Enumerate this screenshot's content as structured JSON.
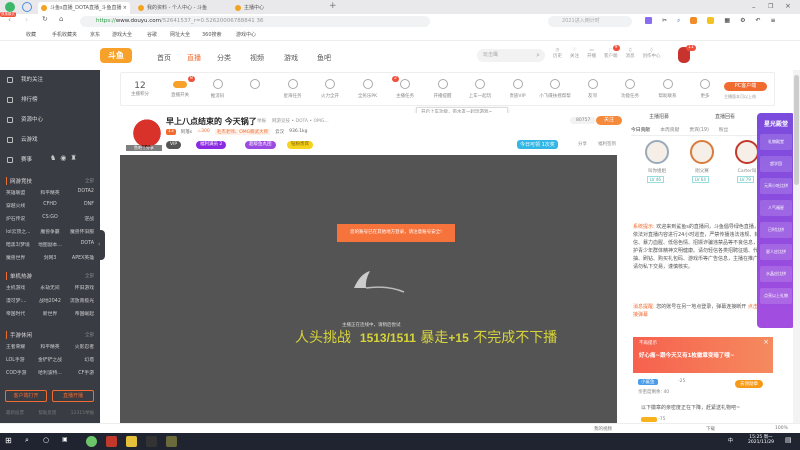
{
  "browser": {
    "tabs": [
      {
        "label": "斗鱼s直播_DOTA直播_斗鱼直播"
      },
      {
        "label": "我的资料 - 个人中心 - 斗鱼"
      },
      {
        "label": "主播中心"
      }
    ],
    "new_tab": "+",
    "badge": "双核模式",
    "url_scheme": "https://",
    "url_host": "www.douyu.com",
    "url_path": "/52641537_r=0.52620006788841 36",
    "search_placeholder": "2021进入倒计时",
    "zoom": "100%",
    "bookmarks": [
      "收藏",
      "手机收藏夹",
      "京东",
      "游戏大全",
      "谷歌",
      "网址大全",
      "360搜索",
      "游戏中心"
    ]
  },
  "site": {
    "logo": "斗鱼",
    "nav": [
      "首页",
      "直播",
      "分类",
      "视频",
      "游戏",
      "鱼吧"
    ],
    "active_nav": "直播",
    "search_placeholder": "玩击鹰",
    "header_icons": [
      "历史",
      "关注",
      "开播",
      "客户端",
      "消息",
      "创作中心"
    ],
    "message_badge": "9",
    "avatar_badge": "11"
  },
  "sidebar": {
    "items": [
      "我的关注",
      "排行榜",
      "资源中心",
      "云游戏",
      "赛事"
    ],
    "sections": [
      {
        "title": "网游竞技",
        "more": "全部",
        "games": [
          "英雄联盟",
          "和平精英",
          "DOTA2",
          "穿越火线",
          "CFHD",
          "DNF",
          "炉石传说",
          "CS:GO",
          "逆战",
          "lol云顶之...",
          "魔兽争霸",
          "魔兽怀旧服",
          "暗黑3/梦境",
          "地图副本...",
          "DOTA",
          "魔兽世界",
          "剑网3",
          "APEX英雄"
        ]
      },
      {
        "title": "单机热游",
        "more": "全部",
        "games": [
          "主机游戏",
          "永劫无间",
          "怀旧游戏",
          "漫可梦:...",
          "战地2042",
          "流放南极光",
          "帝国时代",
          "新世界",
          "帝国崛起"
        ]
      },
      {
        "title": "手游休闲",
        "more": "全部",
        "games": [
          "王者荣耀",
          "和平精英",
          "火影忍者",
          "LOL手游",
          "金铲铲之战",
          "幻塔",
          "COD手游",
          "哈利波特...",
          "CF手游"
        ]
      }
    ],
    "buttons": [
      "客户端打开",
      "直播开播"
    ],
    "footer": [
      "最新投票",
      "帮助反馈",
      "12315举报"
    ]
  },
  "toolbar": {
    "score": "12",
    "score_label": "主播积分",
    "items": [
      "直播开关",
      "推流码",
      "",
      "星海任务",
      "火力全开",
      "全民乐PK",
      "主播任务",
      "开播提醒",
      "上车一起玩",
      "贵族VIP",
      "小飞碟扶摇帮帮",
      "友邻",
      "功能任务",
      "帮助联系",
      "更多"
    ],
    "switch_badge": "8",
    "task_badge": "2",
    "pc_button": "PC客户端",
    "pc_sub": "主播版本可以上线",
    "tooltip": "开启上车功能，带水友一起玩游戏~"
  },
  "streamer": {
    "title": "早上八点结束的 今天锅了",
    "report": "举报",
    "category": "网游竞技 • DOTA • OMG...",
    "level": "13",
    "name": "阿落s",
    "heat": "300",
    "guild": "毛杰老师、OMG撕武大师",
    "location": "云汉",
    "weight": "936.1kg",
    "tags": [
      "VIP",
      "福利满员 2",
      "超级鱼丸团",
      "钻粉贵宾"
    ],
    "fans": "80757",
    "follow": "关注",
    "today_label": "今日可领 1次奖",
    "share": "分享",
    "gift": "福利签到",
    "avatar_caption": "鱼吧 | 分享"
  },
  "video": {
    "warning": "您的账号已在其他地方登录，请注意账号安全!",
    "loading": "主播正在连线中，请稍后尝试",
    "subtitle_a": "人头挑战",
    "subtitle_score": "1513/1511",
    "subtitle_b": "暴走",
    "subtitle_bonus": "+15",
    "subtitle_c": "不完成不下播"
  },
  "right_panel": {
    "links": [
      "主播招募",
      "直播回看"
    ],
    "tabs": [
      "今日贡献",
      "本周贡献",
      "贵宾(19)",
      "粉丝"
    ],
    "top3": [
      {
        "name": "叫你姐姐",
        "lv": "LV 46"
      },
      {
        "name": "刚父赛",
        "lv": "LV 64"
      },
      {
        "name": "Carter叫",
        "lv": "LV 79"
      }
    ],
    "system_label": "系统提示:",
    "system_msg": "欢迎来到鲨鱼s的直播间，斗鱼倡导绿色直播，斗鱼依法对直播内容进行24小时巡查，严禁传播违法违规、封建迷信、暴力血腥、低俗色情、招嫖诈骗违禁品等不良信息，坚决维护青少年群体精神文明健康。请勿轻信各类招聘征婚、代练代抽、刷钻、购买礼包码、游戏币等广告信息，主播在推广商品中请勿私下交易，谨慎核实。",
    "notice_label": "消息提醒:",
    "notice_msg": "您的账号在另一地点登录，弹幕连接断开",
    "notice_link": "点击重新连接弹幕",
    "promo_dismiss": "不再提示",
    "promo_text": "好心痛~跟今天又有1枚徽章变暗了哦~",
    "fan_badge": "小鲨鱼",
    "fan_count": "-25",
    "fan_sub": "亲密度剩余: 40",
    "fan_btn": "去领勋章",
    "fading_msg": "以下徽章的亲密度正在下降，赶紧送礼物吧~",
    "fan_count2": "-75"
  },
  "activity": {
    "title": "星光殿堂",
    "items": [
      "礼物殿堂",
      "超学团",
      "元宵小吃比拼",
      "人气福星",
      "已时比拼",
      "星人应比拼",
      "水晶应比拼",
      "点亮以上礼物"
    ]
  },
  "statusbar": {
    "items": [
      "我的视频",
      "下载"
    ],
    "zoom": "100%"
  },
  "taskbar": {
    "time": "15:25 周一",
    "date": "2021/11/29",
    "lang": "中"
  }
}
